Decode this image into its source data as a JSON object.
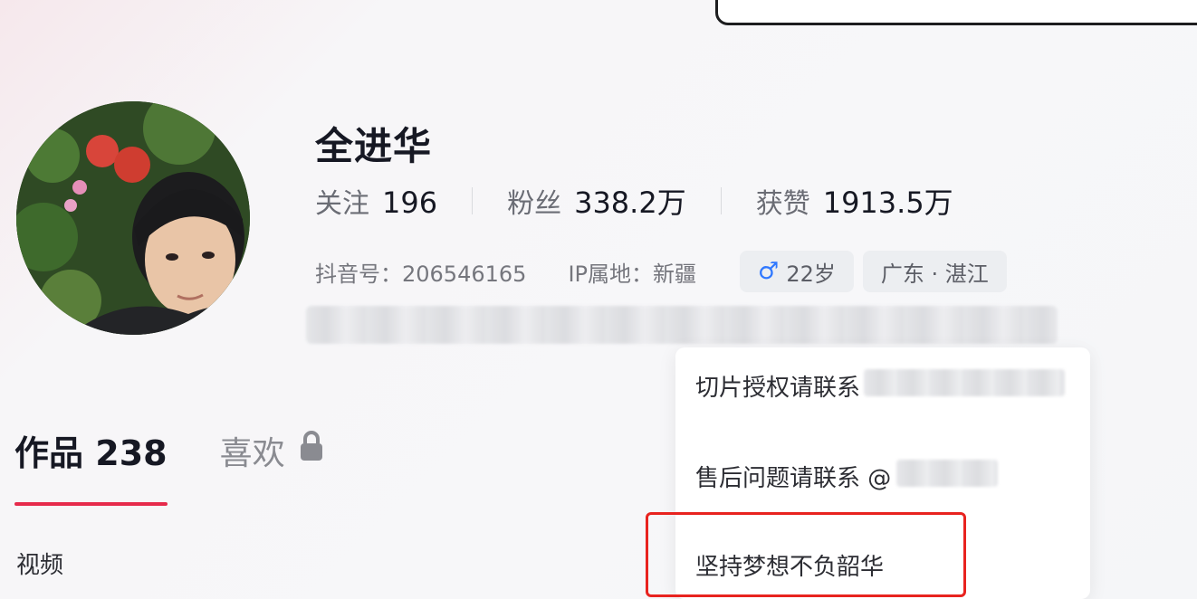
{
  "profile": {
    "name": "全进华",
    "stats": [
      {
        "label": "关注",
        "value": "196"
      },
      {
        "label": "粉丝",
        "value": "338.2万"
      },
      {
        "label": "获赞",
        "value": "1913.5万"
      }
    ],
    "douyin_id": "抖音号：206546165",
    "ip_location": "IP属地：新疆",
    "age": "22岁",
    "region": "广东 · 湛江",
    "gender_symbol": "♂"
  },
  "dropdown": {
    "items": [
      "切片授权请联系",
      "售后问题请联系 @",
      "坚持梦想不负韶华"
    ]
  },
  "tabs": {
    "works_label": "作品",
    "works_count": "238",
    "likes_label": "喜欢"
  },
  "subtab": "视频",
  "colors": {
    "accent": "#e62a4b",
    "highlight": "#e8231f",
    "male": "#2f78ff"
  }
}
